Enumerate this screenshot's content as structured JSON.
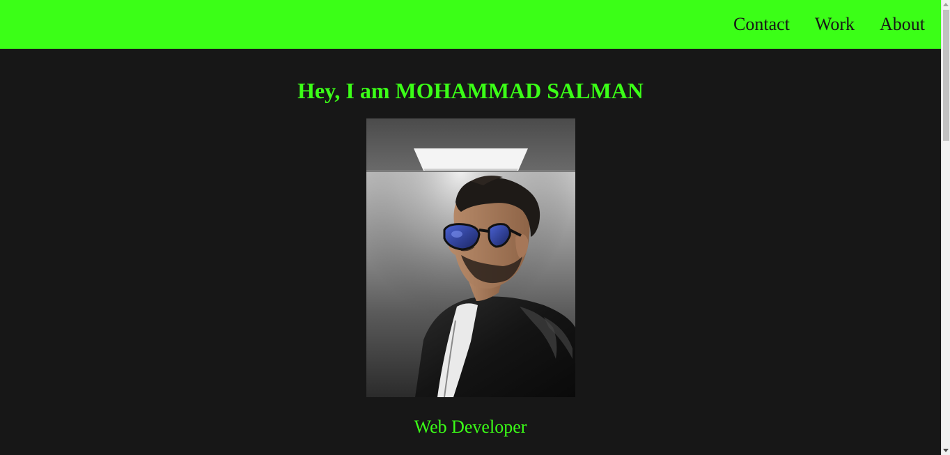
{
  "nav": {
    "items": [
      {
        "label": "Contact"
      },
      {
        "label": "Work"
      },
      {
        "label": "About"
      }
    ]
  },
  "hero": {
    "title": "Hey, I am MOHAMMAD SALMAN",
    "subtitle": "Web Developer",
    "photo_icon": "profile-photo"
  },
  "theme": {
    "accent": "#3bff17",
    "background": "#171717",
    "nav_text": "#171717"
  }
}
